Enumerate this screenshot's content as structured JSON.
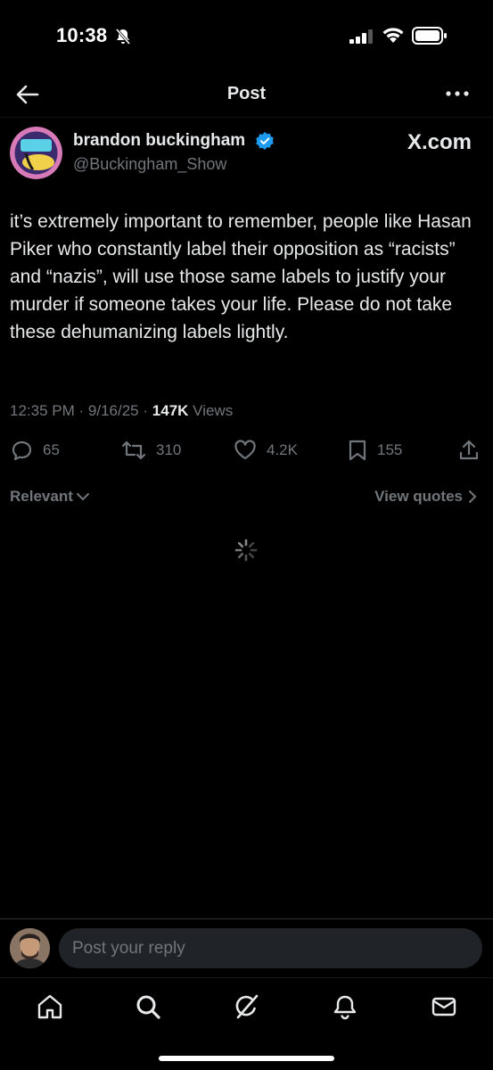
{
  "status_bar": {
    "time": "10:38",
    "icons": [
      "bell-slash-icon",
      "cellular-signal-icon",
      "wifi-icon",
      "battery-icon"
    ]
  },
  "header": {
    "title": "Post",
    "back_icon": "arrow-left-icon",
    "more_icon": "ellipsis-icon"
  },
  "post": {
    "author_name": "brandon buckingham",
    "author_handle": "@Buckingham_Show",
    "verified": true,
    "source_label": "X.com",
    "text": "it’s extremely important to remember, people like Hasan Piker who constantly label their opposition as “racists” and “nazis”, will use those same labels to justify your murder if someone takes your life. Please do not take these dehumanizing labels lightly.",
    "time": "12:35 PM",
    "date": "9/16/25",
    "views_count": "147K",
    "views_label": "Views",
    "separator": "·"
  },
  "actions": {
    "replies": "65",
    "reposts": "310",
    "likes": "4.2K",
    "bookmarks": "155"
  },
  "sort": {
    "relevant_label": "Relevant",
    "view_quotes_label": "View quotes"
  },
  "reply": {
    "placeholder": "Post your reply"
  },
  "bottom_nav": {
    "items": [
      "home-icon",
      "search-icon",
      "grok-icon",
      "notifications-icon",
      "messages-icon"
    ]
  },
  "colors": {
    "background": "#000000",
    "text_primary": "#e7e9ea",
    "text_secondary": "#71767b",
    "verified_blue": "#1d9bf0",
    "input_bg": "#202327"
  }
}
